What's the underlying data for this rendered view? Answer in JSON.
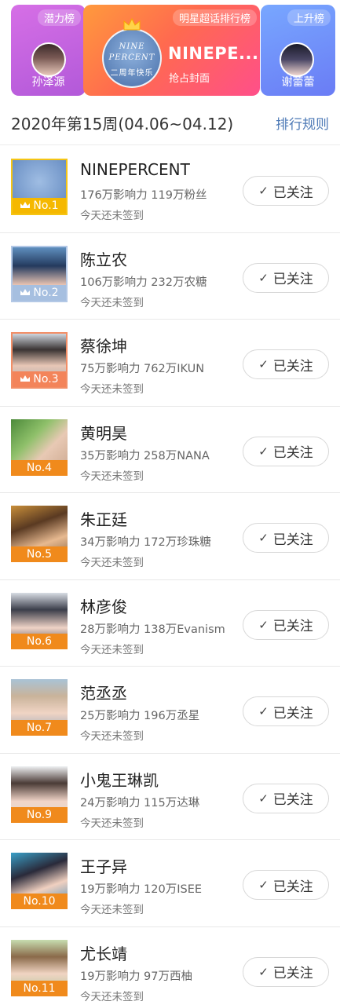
{
  "banner": {
    "left": {
      "tag": "潜力榜",
      "name": "孙泽源"
    },
    "middle": {
      "tag": "明星超话排行榜",
      "title": "NINEPE...",
      "subtitle": "抢占封面",
      "logo_top": "NINE",
      "logo_mid": "PERCENT",
      "logo_bottom": "二周年快乐"
    },
    "right": {
      "tag": "上升榜",
      "name": "谢蕾蕾"
    }
  },
  "header": {
    "week": "2020年第15周(04.06~04.12)",
    "rules_link": "排行规则"
  },
  "follow_label": "已关注",
  "checkin_text": "今天还未签到",
  "rows": [
    {
      "rank": "No.1",
      "name": "NINEPERCENT",
      "stats": "176万影响力 119万粉丝",
      "checkin": "今天还未签到",
      "follow": "已关注"
    },
    {
      "rank": "No.2",
      "name": "陈立农",
      "stats": "106万影响力 232万农糖",
      "checkin": "今天还未签到",
      "follow": "已关注"
    },
    {
      "rank": "No.3",
      "name": "蔡徐坤",
      "stats": "75万影响力 762万IKUN",
      "checkin": "今天还未签到",
      "follow": "已关注"
    },
    {
      "rank": "No.4",
      "name": "黄明昊",
      "stats": "35万影响力 258万NANA",
      "checkin": "今天还未签到",
      "follow": "已关注"
    },
    {
      "rank": "No.5",
      "name": "朱正廷",
      "stats": "34万影响力 172万珍珠糖",
      "checkin": "今天还未签到",
      "follow": "已关注"
    },
    {
      "rank": "No.6",
      "name": "林彦俊",
      "stats": "28万影响力 138万Evanism",
      "checkin": "今天还未签到",
      "follow": "已关注"
    },
    {
      "rank": "No.7",
      "name": "范丞丞",
      "stats": "25万影响力 196万丞星",
      "checkin": "今天还未签到",
      "follow": "已关注"
    },
    {
      "rank": "No.9",
      "name": "小鬼王琳凯",
      "stats": "24万影响力 115万达琳",
      "checkin": "今天还未签到",
      "follow": "已关注"
    },
    {
      "rank": "No.10",
      "name": "王子异",
      "stats": "19万影响力 120万ISEE",
      "checkin": "今天还未签到",
      "follow": "已关注"
    },
    {
      "rank": "No.11",
      "name": "尤长靖",
      "stats": "19万影响力 97万西柚",
      "checkin": "今天还未签到",
      "follow": "已关注"
    }
  ]
}
